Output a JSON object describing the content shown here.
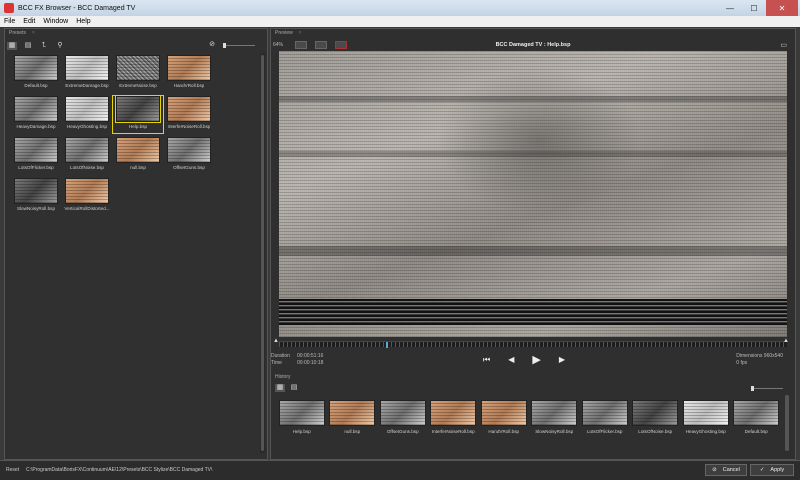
{
  "window": {
    "title": "BCC FX Browser - BCC Damaged TV",
    "min": "—",
    "max": "☐",
    "close": "✕"
  },
  "menu": [
    "File",
    "Edit",
    "Window",
    "Help"
  ],
  "presets_panel": {
    "label": "Presets",
    "close": "×",
    "items": [
      {
        "label": "Default.bsp",
        "style": "gray"
      },
      {
        "label": "ExtremeDamage.bsp",
        "style": "light"
      },
      {
        "label": "ExtremeNoise.bsp",
        "style": "noise"
      },
      {
        "label": "HandVRoll.bsp",
        "style": "warm"
      },
      {
        "label": "HeavyDamage.bsp",
        "style": "gray"
      },
      {
        "label": "HeavyGhosting.bsp",
        "style": "light"
      },
      {
        "label": "Help.bsp",
        "style": "dark"
      },
      {
        "label": "InterferNoiseRoll.bsp",
        "style": "warm"
      },
      {
        "label": "LotsOfFlicker.bsp",
        "style": "gray"
      },
      {
        "label": "LotsOfNoise.bsp",
        "style": "gray"
      },
      {
        "label": "null.bsp",
        "style": "warm"
      },
      {
        "label": "OffsetGuns.bsp",
        "style": "gray"
      },
      {
        "label": "SlowNoisyRoll.bsp",
        "style": "dark"
      },
      {
        "label": "VerticalRollDistorted...",
        "style": "warm"
      }
    ],
    "selected_index": 6
  },
  "preview": {
    "label": "Preview",
    "close": "×",
    "zoom": "64%",
    "title": "BCC Damaged TV : Help.bsp",
    "duration_label": "Duration",
    "duration": "00:00:51:16",
    "time_label": "Time",
    "time": "00:00:10:18",
    "dimensions": "Dimensions 960x540",
    "fps": "0 fps",
    "playhead_fraction": 0.21
  },
  "history": {
    "label": "History",
    "items": [
      {
        "label": "Help.bsp",
        "style": "gray"
      },
      {
        "label": "null.bsp",
        "style": "warm"
      },
      {
        "label": "OffsetGuns.bsp",
        "style": "gray"
      },
      {
        "label": "InterferNoiseRoll.bsp",
        "style": "warm"
      },
      {
        "label": "HandVRoll.bsp",
        "style": "warm"
      },
      {
        "label": "SlowNoisyRoll.bsp",
        "style": "gray"
      },
      {
        "label": "LotsOfFlicker.bsp",
        "style": "gray"
      },
      {
        "label": "LotsOfNoise.bsp",
        "style": "dark"
      },
      {
        "label": "HeavyGhosting.bsp",
        "style": "light"
      },
      {
        "label": "Default.bsp",
        "style": "gray"
      }
    ]
  },
  "status": {
    "reset_label": "Reset",
    "path": "C:\\ProgramData\\BorisFX\\Continuum\\AE\\12\\Presets\\BCC Stylize\\BCC Damaged TV\\",
    "cancel": "Cancel",
    "apply": "Apply"
  },
  "colors": {
    "accent_selected": "#e6d400",
    "playhead": "#5aa8d8"
  }
}
